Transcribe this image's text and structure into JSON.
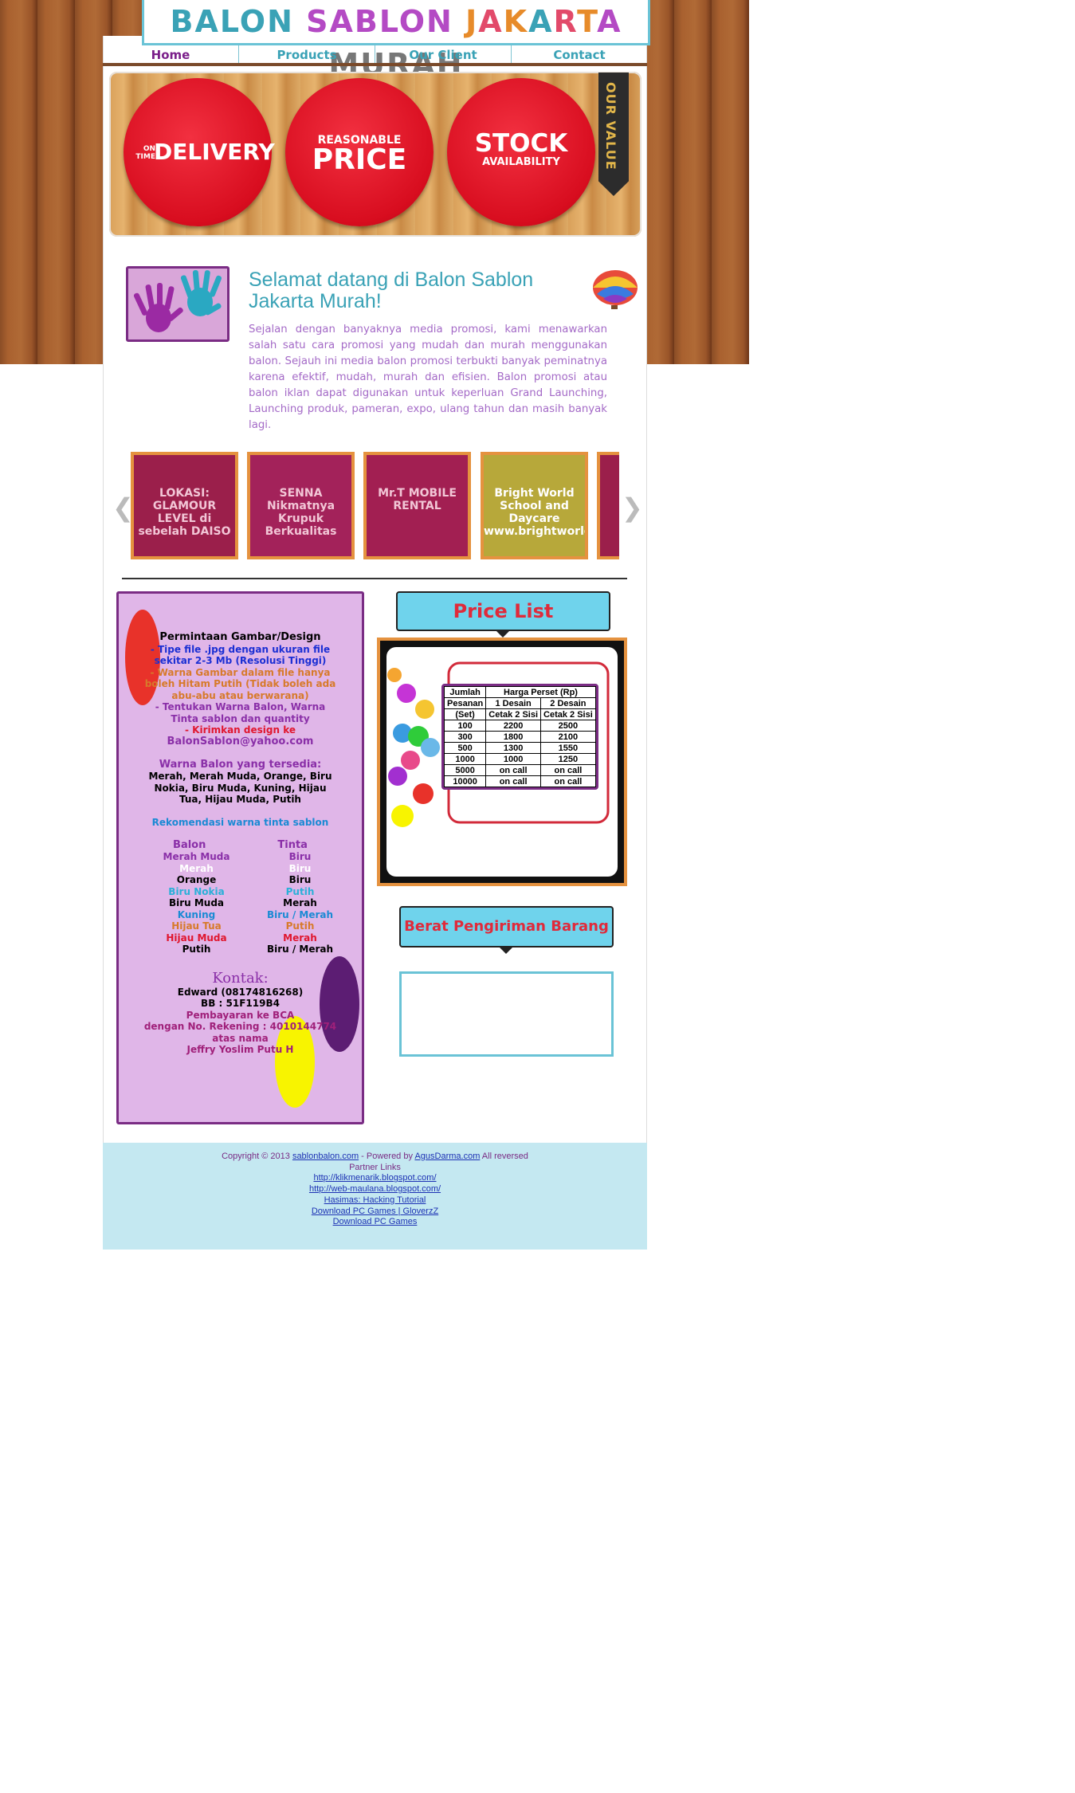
{
  "site": {
    "title": "BALON SABLON JAKARTA MURAH"
  },
  "nav": {
    "items": [
      "Home",
      "Products",
      "Our Client",
      "Contact"
    ]
  },
  "banner": {
    "circles": [
      {
        "small_top": "ON",
        "small_bottom": "TIME",
        "big": "DELIVERY"
      },
      {
        "small": "REASONABLE",
        "big": "PRICE"
      },
      {
        "big": "STOCK",
        "small": "AVAILABILITY"
      }
    ],
    "ribbon": "OUR VALUE"
  },
  "welcome": {
    "title": "Selamat datang di Balon Sablon Jakarta Murah!",
    "body": "Sejalan dengan banyaknya media promosi, kami menawarkan salah satu cara promosi yang mudah dan murah menggunakan balon. Sejauh ini media balon promosi terbukti banyak peminatnya karena efektif, mudah, murah dan efisien. Balon promosi atau balon iklan dapat digunakan untuk keperluan Grand Launching, Launching produk, pameran, expo, ulang tahun dan masih banyak lagi."
  },
  "gallery": {
    "items": [
      {
        "text": "LOKASI: GLAMOUR LEVEL di sebelah DAISO",
        "color": "#9b1f4b"
      },
      {
        "text": "SENNA Nikmatnya Krupuk Berkualitas",
        "color": "#a3225a"
      },
      {
        "text": "Mr.T MOBILE RENTAL",
        "color": "#a21f52"
      },
      {
        "text": "Bright World School and Daycare www.brightworldschool.com",
        "color": "#b7a83a"
      }
    ],
    "prev_icon": "chevron-left-icon",
    "next_icon": "chevron-right-icon"
  },
  "poster": {
    "lines": [
      {
        "t": "Permintaan Gambar/Design",
        "c": "#000"
      },
      {
        "t": "- Tipe file .jpg dengan ukuran file",
        "c": "#1b2fd4"
      },
      {
        "t": "sekitar 2-3 Mb (Resolusi Tinggi)",
        "c": "#1b2fd4"
      },
      {
        "t": "- Warna Gambar dalam file hanya",
        "c": "#d77a2a"
      },
      {
        "t": "boleh Hitam Putih (Tidak boleh ada",
        "c": "#d77a2a"
      },
      {
        "t": "abu-abu atau berwarana)",
        "c": "#d77a2a"
      },
      {
        "t": "- Tentukan Warna Balon, Warna",
        "c": "#8a2fa8"
      },
      {
        "t": "Tinta sablon dan quantity",
        "c": "#8a2fa8"
      },
      {
        "t": "- Kirimkan design ke",
        "c": "#e0162e"
      },
      {
        "t": "BalonSablon@yahoo.com",
        "c": "#8a2fa8"
      },
      {
        "t": "",
        "c": "#000"
      },
      {
        "t": "Warna Balon yang tersedia:",
        "c": "#8a2fa8"
      },
      {
        "t": "Merah, Merah Muda, Orange, Biru",
        "c": "#000"
      },
      {
        "t": "Nokia, Biru Muda, Kuning, Hijau",
        "c": "#000"
      },
      {
        "t": "Tua, Hijau Muda, Putih",
        "c": "#000"
      },
      {
        "t": "",
        "c": "#000"
      },
      {
        "t": "Rekomendasi warna tinta sablon",
        "c": "#1a8ad4"
      }
    ],
    "table_head": [
      "Balon",
      "Tinta"
    ],
    "table_rows": [
      [
        "Merah Muda",
        "Biru",
        "#8a2fa8",
        "#8a2fa8"
      ],
      [
        "Merah",
        "Biru",
        "#fff",
        "#fff"
      ],
      [
        "Orange",
        "Biru",
        "#000",
        "#000"
      ],
      [
        "Biru Nokia",
        "Putih",
        "#2ab0d8",
        "#2ab0d8"
      ],
      [
        "Biru Muda",
        "Merah",
        "#000",
        "#000"
      ],
      [
        "Kuning",
        "Biru / Merah",
        "#1a8ad4",
        "#1a8ad4"
      ],
      [
        "Hijau Tua",
        "Putih",
        "#d77a2a",
        "#d77a2a"
      ],
      [
        "Hijau Muda",
        "Merah",
        "#e0162e",
        "#e0162e"
      ],
      [
        "Putih",
        "Biru / Merah",
        "#000",
        "#000"
      ]
    ],
    "kontak_title": "Kontak:",
    "kontak": [
      {
        "t": "Edward (08174816268)",
        "c": "#000"
      },
      {
        "t": "BB : 51F119B4",
        "c": "#000"
      },
      {
        "t": "Pembayaran ke BCA",
        "c": "#a0207a"
      },
      {
        "t": "dengan No. Rekening : 4010144774",
        "c": "#a0207a"
      },
      {
        "t": "atas nama",
        "c": "#a0207a"
      },
      {
        "t": "Jeffry Yoslim Putu H",
        "c": "#a0207a"
      }
    ]
  },
  "pricelist": {
    "badge": "Price List",
    "head1": [
      "Jumlah",
      "Harga Perset  (Rp)"
    ],
    "head2": [
      "Pesanan",
      "1 Desain",
      "2 Desain"
    ],
    "head3": [
      "(Set)",
      "Cetak 2 Sisi",
      "Cetak 2 Sisi"
    ],
    "rows": [
      [
        "100",
        "2200",
        "2500"
      ],
      [
        "300",
        "1800",
        "2100"
      ],
      [
        "500",
        "1300",
        "1550"
      ],
      [
        "1000",
        "1000",
        "1250"
      ],
      [
        "5000",
        "on call",
        "on call"
      ],
      [
        "10000",
        "on call",
        "on call"
      ]
    ]
  },
  "berat": {
    "badge": "Berat Pengiriman Barang"
  },
  "footer": {
    "copyright_pre": "Copyright © 2013 ",
    "site_link": "sablonbalon.com",
    "powered": " - Powered by ",
    "agus_link": "AgusDarma.com",
    "reserved": " All reversed",
    "partner_title": "Partner Links",
    "links": [
      "http://klikmenarik.blogspot.com/",
      "http://web-maulana.blogspot.com/",
      "Hasimas: Hacking Tutorial",
      "Download PC Games | GloverzZ",
      "Download PC Games"
    ]
  }
}
